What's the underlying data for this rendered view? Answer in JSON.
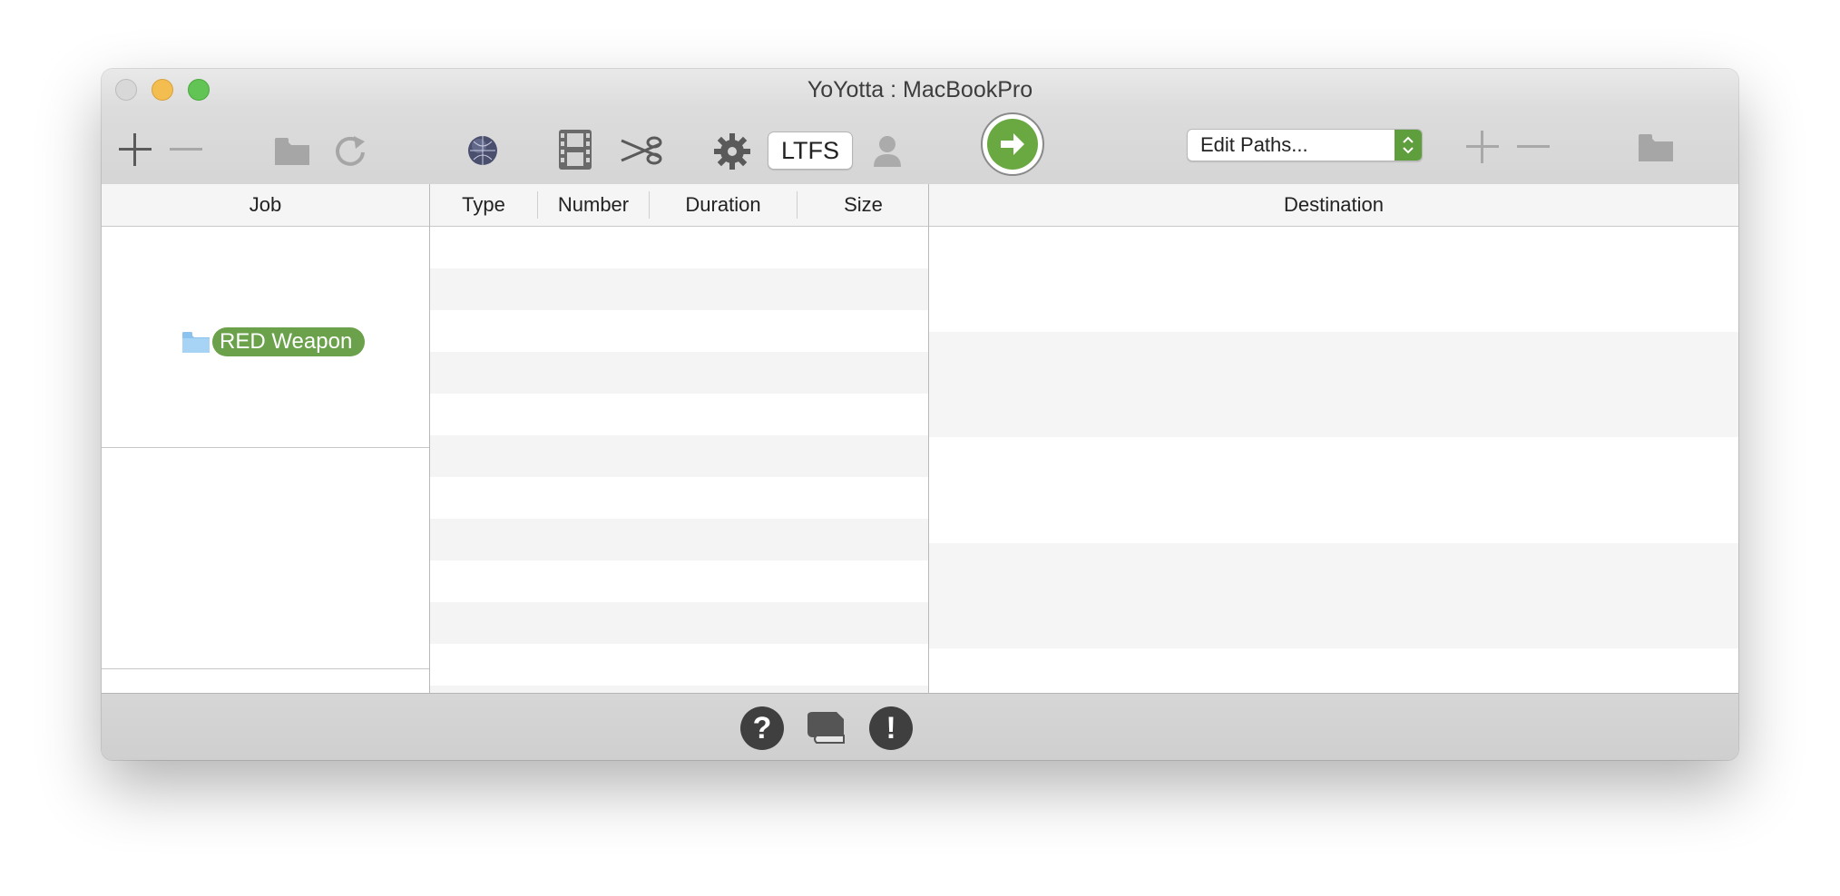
{
  "window": {
    "title": "YoYotta : MacBookPro"
  },
  "toolbar": {
    "ltfs_label": "LTFS",
    "paths_popup": "Edit Paths...",
    "icons": [
      "add-icon",
      "remove-icon",
      "folder-icon",
      "refresh-icon",
      "network-globe-icon",
      "film-icon",
      "scissors-icon",
      "gear-icon",
      "user-icon",
      "go-arrow-icon",
      "add-path-icon",
      "remove-path-icon",
      "path-folder-icon"
    ]
  },
  "columns": {
    "job": "Job",
    "type": "Type",
    "number": "Number",
    "duration": "Duration",
    "size": "Size",
    "destination": "Destination"
  },
  "jobs": [
    {
      "label": "RED Weapon",
      "tag_color": "#6aa14a"
    }
  ],
  "bottombar": {
    "icons": [
      "help-icon",
      "log-book-icon",
      "alert-icon"
    ],
    "help_glyph": "?",
    "alert_glyph": "!"
  },
  "colors": {
    "accent_green": "#6aa842",
    "folder_blue": "#8cc2ee"
  }
}
